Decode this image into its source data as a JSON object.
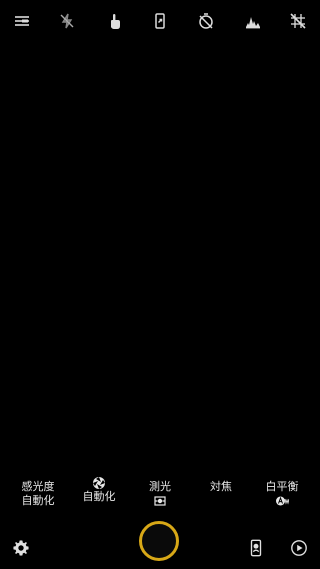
{
  "top_bar": {
    "icons": [
      "menu-icon",
      "flash-off-icon",
      "touch-shutter-icon",
      "rotate-icon",
      "timer-off-icon",
      "histogram-icon",
      "grid-off-icon"
    ]
  },
  "settings": {
    "iso": {
      "label": "感光度",
      "value": "自動化"
    },
    "shutter_speed": {
      "icon": "aperture-icon",
      "value": "自動化"
    },
    "metering": {
      "label": "測光",
      "icon": "metering-icon"
    },
    "focus": {
      "label": "対焦"
    },
    "white_balance": {
      "label": "白平衡",
      "icon": "awb-icon"
    }
  },
  "bottom_bar": {
    "icons": [
      "settings-icon",
      "shutter-button",
      "camera-switch-icon",
      "play-icon"
    ]
  },
  "colors": {
    "accent": "#d8a817",
    "background": "#000000",
    "text": "#e6e6e6"
  }
}
